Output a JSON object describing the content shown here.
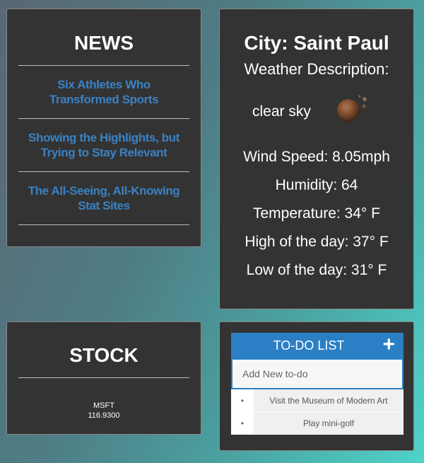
{
  "news": {
    "title": "NEWS",
    "items": [
      {
        "title": "Six Athletes Who Transformed Sports"
      },
      {
        "title": "Showing the Highlights, but Trying to Stay Relevant"
      },
      {
        "title": "The All-Seeing, All-Knowing Stat Sites"
      }
    ]
  },
  "weather": {
    "city": "City: Saint Paul",
    "description_label": "Weather Description:",
    "description": "clear sky",
    "icon": "night-moon-icon",
    "wind_speed": "Wind Speed: 8.05mph",
    "humidity": "Humidity: 64",
    "temperature": "Temperature: 34° F",
    "high": "High of the day: 37° F",
    "low": "Low of the day: 31° F"
  },
  "stock": {
    "title": "STOCK",
    "symbol": "MSFT",
    "price": "116.9300"
  },
  "todo": {
    "title": "TO-DO LIST",
    "add_icon": "plus-icon",
    "input_placeholder": "Add New to-do",
    "items": [
      {
        "text": "Visit the Museum of Modern Art"
      },
      {
        "text": "Play mini-golf"
      }
    ]
  },
  "colors": {
    "card_background": "#333333",
    "link_blue": "#3a82c4",
    "todo_header_blue": "#2b7fc4"
  }
}
